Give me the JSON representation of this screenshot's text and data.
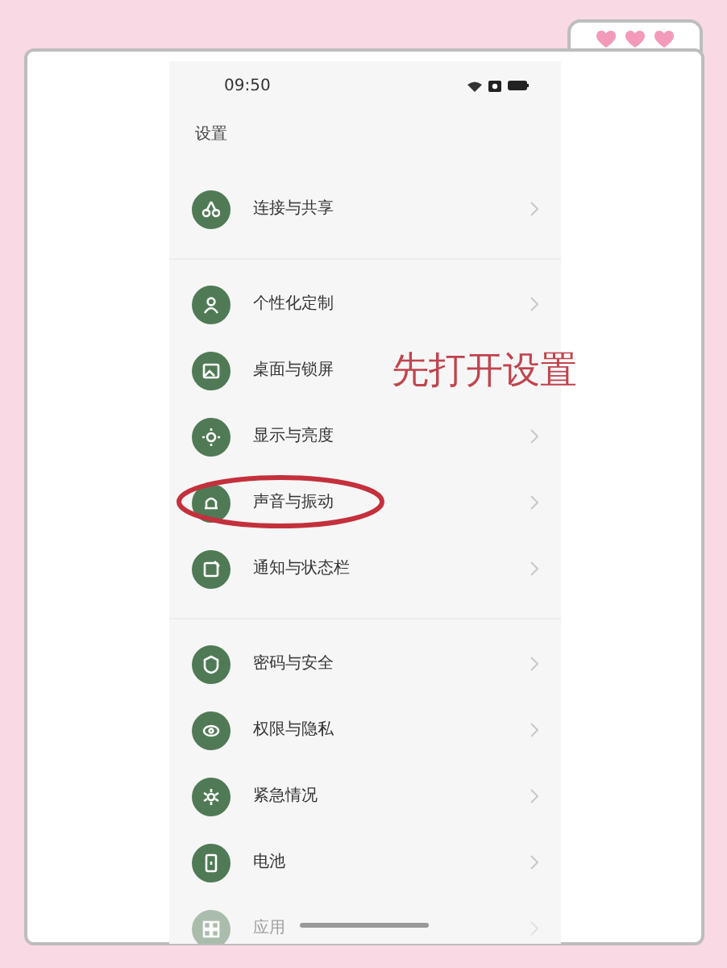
{
  "status_bar": {
    "time": "09:50"
  },
  "title": "设置",
  "groups": [
    {
      "items": [
        {
          "label": "连接与共享",
          "circled": false,
          "faded": false
        }
      ]
    },
    {
      "items": [
        {
          "label": "个性化定制",
          "circled": false,
          "faded": false
        },
        {
          "label": "桌面与锁屏",
          "circled": false,
          "faded": false
        },
        {
          "label": "显示与亮度",
          "circled": false,
          "faded": false
        },
        {
          "label": "声音与振动",
          "circled": true,
          "faded": false
        },
        {
          "label": "通知与状态栏",
          "circled": false,
          "faded": false
        }
      ]
    },
    {
      "items": [
        {
          "label": "密码与安全",
          "circled": false,
          "faded": false
        },
        {
          "label": "权限与隐私",
          "circled": false,
          "faded": false
        },
        {
          "label": "紧急情况",
          "circled": false,
          "faded": false
        },
        {
          "label": "电池",
          "circled": false,
          "faded": false
        },
        {
          "label": "应用",
          "circled": false,
          "faded": true
        }
      ]
    }
  ],
  "annotation": {
    "text": "先打开设置"
  }
}
